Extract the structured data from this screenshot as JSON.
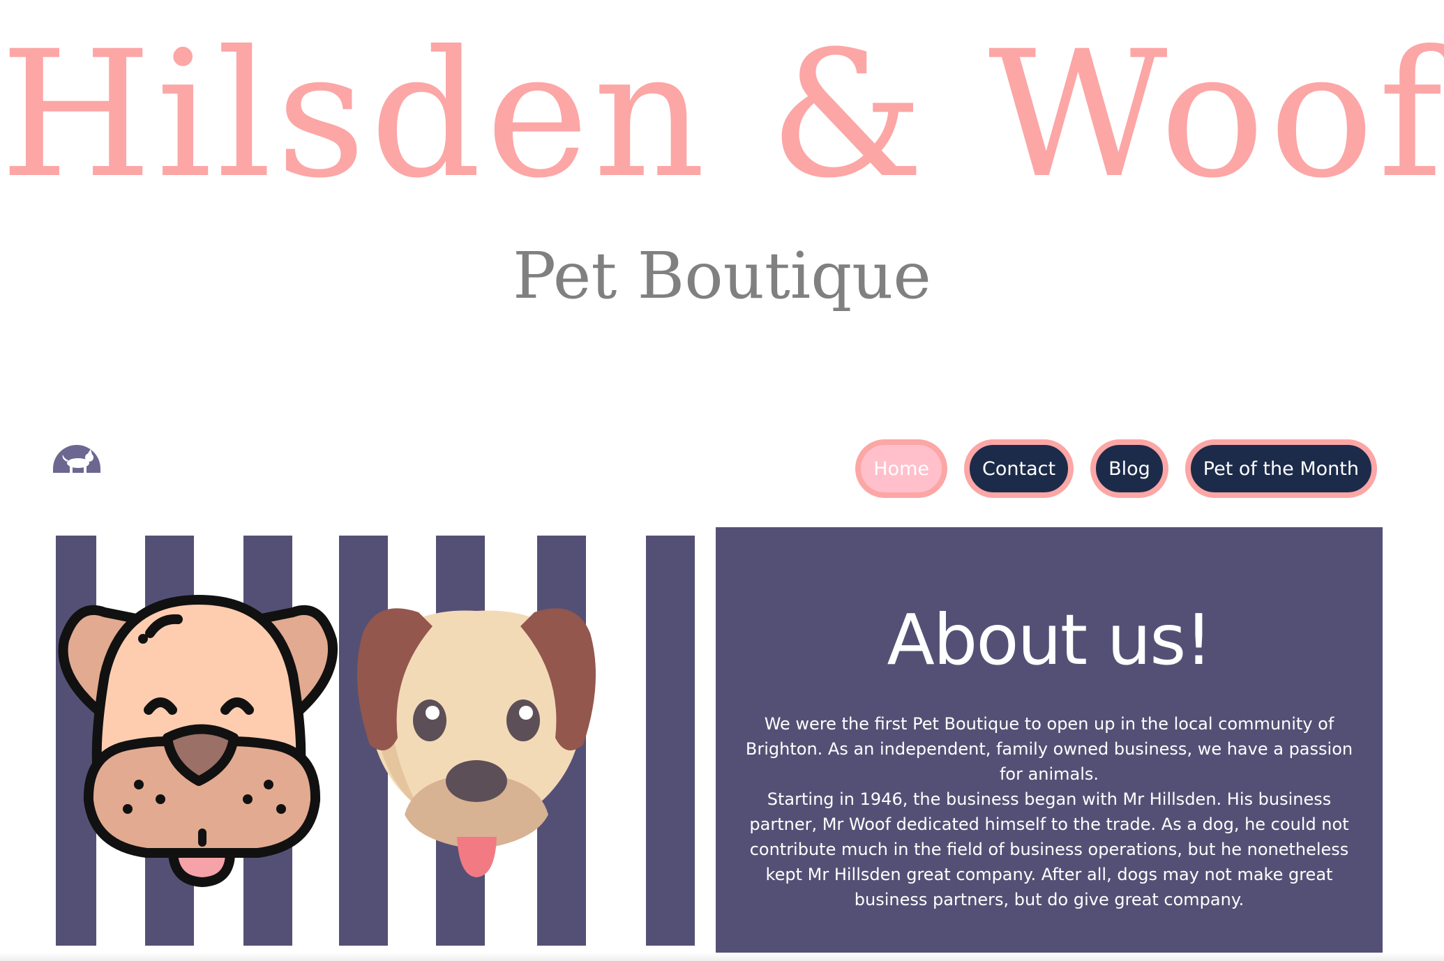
{
  "header": {
    "title": "Hilsden & Woof",
    "subtitle": "Pet Boutique"
  },
  "nav": {
    "items": [
      {
        "label": "Home",
        "active": true
      },
      {
        "label": "Contact",
        "active": false
      },
      {
        "label": "Blog",
        "active": false
      },
      {
        "label": "Pet of the Month",
        "active": false
      }
    ]
  },
  "hero": {
    "illustration_icons": [
      "dog-logo-icon",
      "cartoon-dog-face-icon",
      "cartoon-puppy-face-icon"
    ]
  },
  "about": {
    "heading": "About us!",
    "paragraph_1": "We were the first Pet Boutique to open up in the local community of Brighton. As an independent, family owned business, we have a passion for animals.",
    "paragraph_2": "Starting in 1946, the business began with Mr Hillsden. His business partner, Mr Woof dedicated himself to the trade. As a dog, he could not contribute much in the field of business operations, but he nonetheless kept Mr Hillsden great company. After all, dogs may not make great business partners, but do give great company."
  },
  "colors": {
    "title_pink": "#fca6a6",
    "subtitle_gray": "#808080",
    "nav_navy": "#1c2b4a",
    "nav_active": "#ffc0cb",
    "about_purple": "#545075"
  }
}
